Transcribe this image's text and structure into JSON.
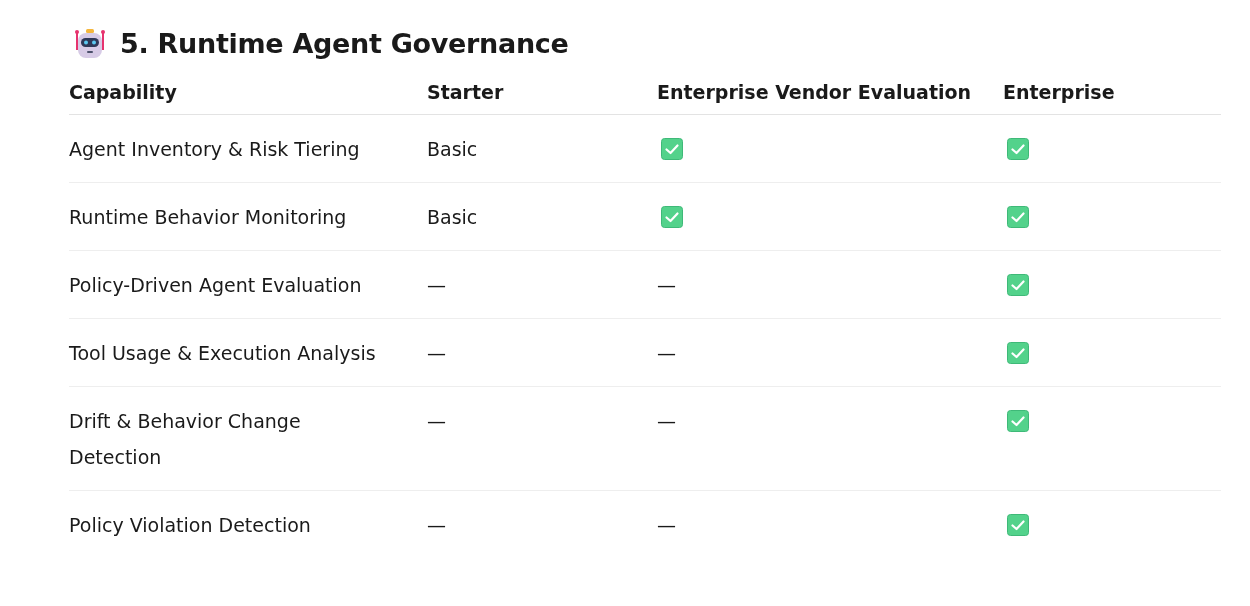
{
  "section": {
    "title": "5. Runtime Agent Governance"
  },
  "table": {
    "columns": [
      "Capability",
      "Starter",
      "Enterprise Vendor Evaluation",
      "Enterprise"
    ],
    "rows": [
      [
        {
          "kind": "text",
          "text": "Agent Inventory & Risk Tiering"
        },
        {
          "kind": "text",
          "text": "Basic"
        },
        {
          "kind": "check"
        },
        {
          "kind": "check"
        }
      ],
      [
        {
          "kind": "text",
          "text": "Runtime Behavior Monitoring"
        },
        {
          "kind": "text",
          "text": "Basic"
        },
        {
          "kind": "check"
        },
        {
          "kind": "check"
        }
      ],
      [
        {
          "kind": "text",
          "text": "Policy-Driven Agent Evaluation"
        },
        {
          "kind": "text",
          "text": "—"
        },
        {
          "kind": "text",
          "text": "—"
        },
        {
          "kind": "check"
        }
      ],
      [
        {
          "kind": "text",
          "text": "Tool Usage & Execution Analysis"
        },
        {
          "kind": "text",
          "text": "—"
        },
        {
          "kind": "text",
          "text": "—"
        },
        {
          "kind": "check"
        }
      ],
      [
        {
          "kind": "text",
          "text": "Drift & Behavior Change Detection"
        },
        {
          "kind": "text",
          "text": "—"
        },
        {
          "kind": "text",
          "text": "—"
        },
        {
          "kind": "check"
        }
      ],
      [
        {
          "kind": "text",
          "text": "Policy Violation Detection"
        },
        {
          "kind": "text",
          "text": "—"
        },
        {
          "kind": "text",
          "text": "—"
        },
        {
          "kind": "check"
        }
      ]
    ]
  }
}
